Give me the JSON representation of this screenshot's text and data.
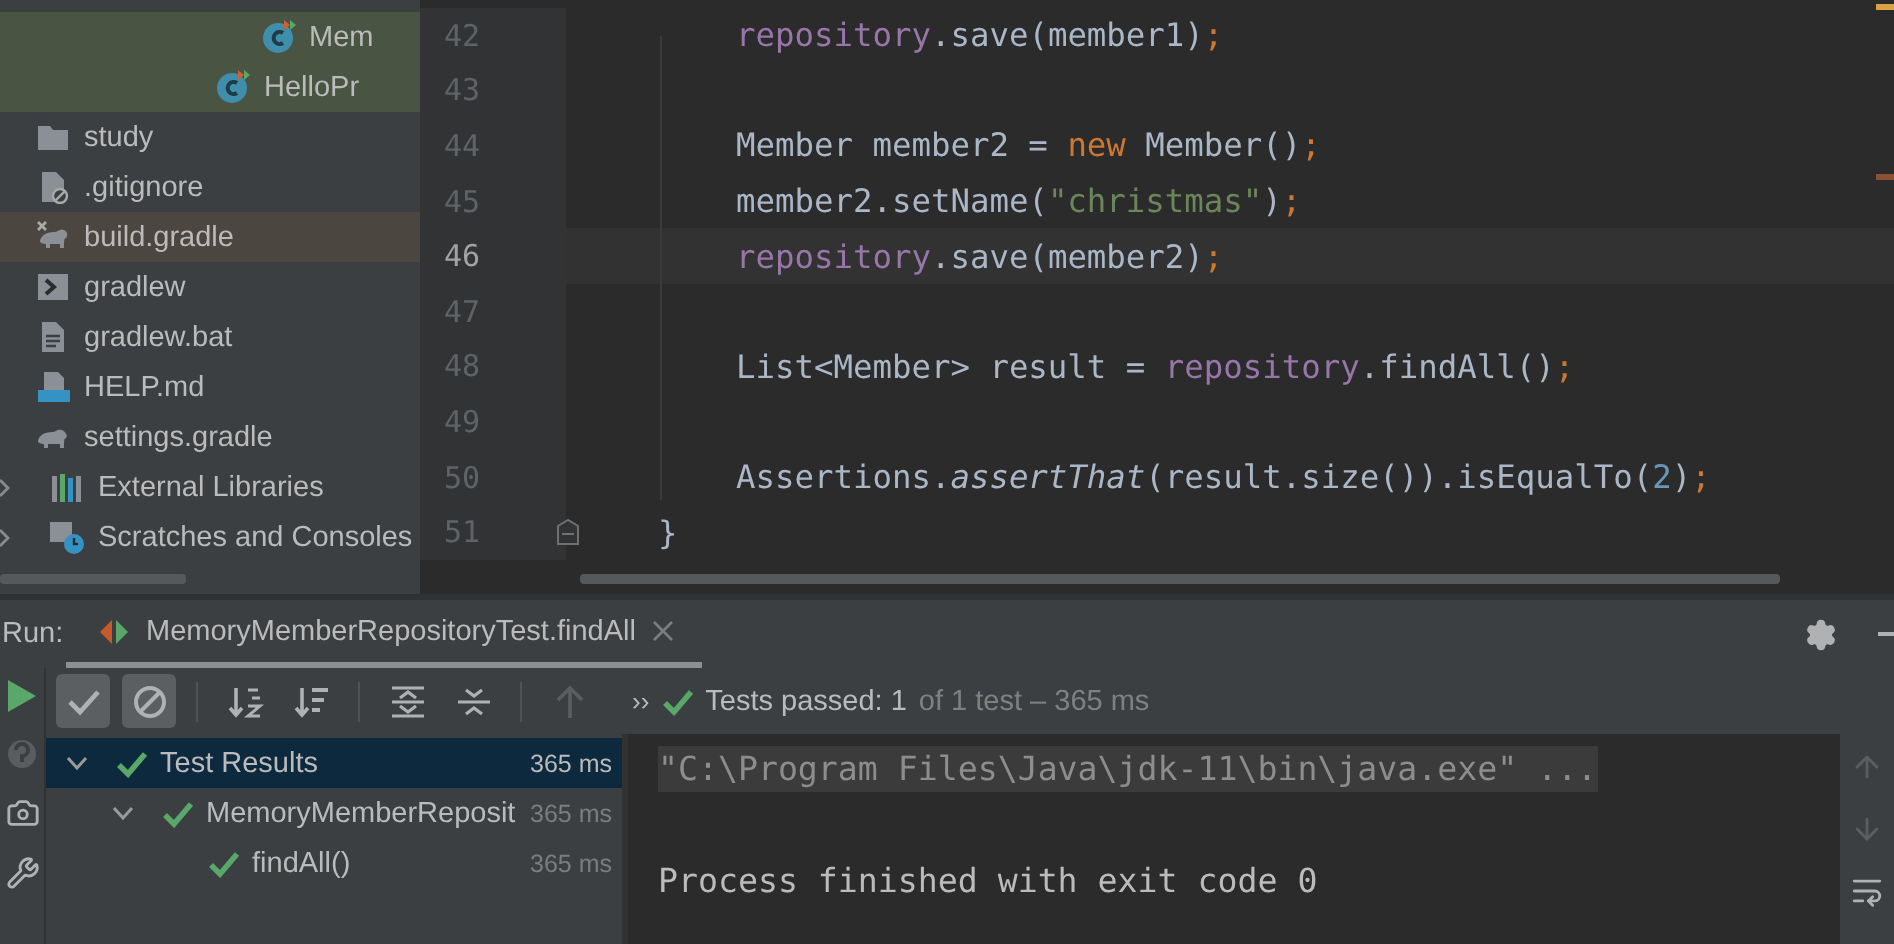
{
  "project_tree": [
    {
      "children": [
        {
          "children": [
            {
              "children": [
                {
                  "children": [
                    {
                      "children": [
                        {
                          "children": [
                            {
                              "label": "Mem",
                              "kind": "class",
                              "selected": false,
                              "color": "#4a5443"
                            }
                          ]
                        },
                        {
                          "label": "HelloPr",
                          "kind": "class",
                          "selected": false,
                          "color": "#4a5443"
                        }
                      ]
                    }
                  ]
                }
              ]
            }
          ]
        },
        {
          "label": "study",
          "kind": "folder",
          "selected": false
        },
        {
          "label": ".gitignore",
          "kind": "ignore-file",
          "selected": false
        },
        {
          "label": "build.gradle",
          "kind": "gradle-build",
          "selected": true
        },
        {
          "label": "gradlew",
          "kind": "terminal",
          "selected": false
        },
        {
          "label": "gradlew.bat",
          "kind": "text-file",
          "selected": false
        },
        {
          "label": "HELP.md",
          "kind": "markdown",
          "selected": false
        },
        {
          "label": "settings.gradle",
          "kind": "gradle",
          "selected": false
        }
      ]
    },
    {
      "label": "External Libraries",
      "kind": "library",
      "selected": false,
      "expanded": false
    },
    {
      "label": "Scratches and Consoles",
      "kind": "scratches",
      "selected": false,
      "expanded": false
    }
  ],
  "editor": {
    "lines": [
      {
        "number": "42",
        "current": false,
        "kind": "body",
        "tokens": [
          {
            "kind": "field",
            "text": "repository"
          },
          {
            "kind": "plain",
            "text": ".save(member1)"
          },
          {
            "kind": "keyword",
            "text": ";"
          }
        ]
      },
      {
        "number": "43",
        "current": false,
        "kind": "blank"
      },
      {
        "number": "44",
        "current": false,
        "kind": "body",
        "tokens": [
          {
            "kind": "plain",
            "text": "Member member2 = "
          },
          {
            "kind": "keyword",
            "text": "new"
          },
          {
            "kind": "plain",
            "text": " Member()"
          },
          {
            "kind": "keyword",
            "text": ";"
          }
        ]
      },
      {
        "number": "45",
        "current": false,
        "kind": "body",
        "tokens": [
          {
            "kind": "plain",
            "text": "member2.setName("
          },
          {
            "kind": "string",
            "text": "\"christmas\""
          },
          {
            "kind": "plain",
            "text": ")"
          },
          {
            "kind": "keyword",
            "text": ";"
          }
        ]
      },
      {
        "number": "46",
        "current": true,
        "kind": "body",
        "tokens": [
          {
            "kind": "field",
            "text": "repository"
          },
          {
            "kind": "plain",
            "text": ".save(member2)"
          },
          {
            "kind": "keyword",
            "text": ";"
          }
        ]
      },
      {
        "number": "47",
        "current": false,
        "kind": "blank"
      },
      {
        "number": "48",
        "current": false,
        "kind": "body",
        "tokens": [
          {
            "kind": "plain",
            "text": "List<Member> result = "
          },
          {
            "kind": "field",
            "text": "repository"
          },
          {
            "kind": "plain",
            "text": ".findAll()"
          },
          {
            "kind": "keyword",
            "text": ";"
          }
        ]
      },
      {
        "number": "49",
        "current": false,
        "kind": "blank"
      },
      {
        "number": "50",
        "current": false,
        "kind": "body",
        "tokens": [
          {
            "kind": "plain",
            "text": "Assertions."
          },
          {
            "kind": "static-method",
            "text": "assertThat"
          },
          {
            "kind": "plain",
            "text": "(result.size()).isEqualTo("
          },
          {
            "kind": "number",
            "text": "2"
          },
          {
            "kind": "plain",
            "text": ")"
          },
          {
            "kind": "keyword",
            "text": ";"
          }
        ]
      },
      {
        "number": "51",
        "current": false,
        "kind": "block-end",
        "fold": true,
        "tokens": [
          {
            "kind": "plain",
            "text": "}"
          }
        ]
      }
    ]
  },
  "run_panel": {
    "label": "Run:",
    "tab": {
      "title": "MemoryMemberRepositoryTest.findAll",
      "selected": true
    },
    "toolbar": [
      {
        "kind": "show-passed",
        "selected": true,
        "disabled": false
      },
      {
        "kind": "show-ignored",
        "selected": true,
        "disabled": false
      },
      {
        "kind": "sort-alpha",
        "selected": false,
        "disabled": false
      },
      {
        "kind": "sort-duration",
        "selected": false,
        "disabled": false
      },
      {
        "kind": "expand-all",
        "selected": false,
        "disabled": false
      },
      {
        "kind": "collapse-all",
        "selected": false,
        "disabled": false
      },
      {
        "kind": "previous",
        "selected": false,
        "disabled": true
      }
    ],
    "more": "››",
    "status": {
      "main": "Tests passed: 1",
      "detail": "of 1 test – 365 ms"
    },
    "tests": [
      {
        "label": "Test Results",
        "time": "365 ms",
        "selected": true,
        "expanded": true,
        "children": [
          {
            "label": "MemoryMemberReposit",
            "time": "365 ms",
            "selected": false,
            "expanded": true,
            "children": [
              {
                "label": "findAll()",
                "time": "365 ms",
                "selected": false
              }
            ]
          }
        ]
      }
    ],
    "console": [
      {
        "kind": "folded",
        "text": "\"C:\\Program Files\\Java\\jdk-11\\bin\\java.exe\" ..."
      },
      {
        "kind": "plain",
        "text": "Process finished with exit code 0"
      }
    ]
  }
}
